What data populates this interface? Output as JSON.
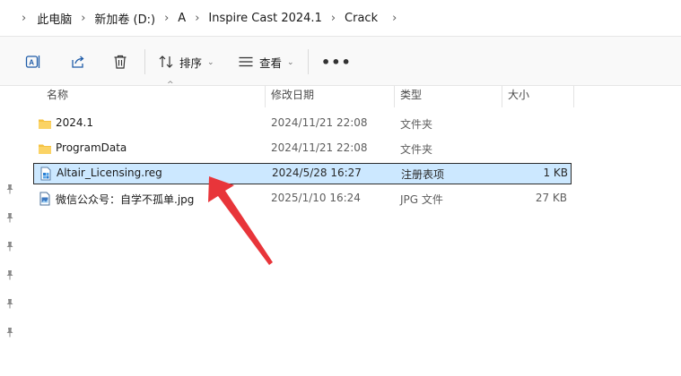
{
  "breadcrumb": {
    "items": [
      "此电脑",
      "新加卷 (D:)",
      "A",
      "Inspire Cast 2024.1",
      "Crack"
    ],
    "separator": "›"
  },
  "toolbar": {
    "sort_label": "排序",
    "view_label": "查看",
    "more_label": "•••",
    "icons": [
      "rename-icon",
      "share-icon",
      "delete-icon",
      "sort-icon",
      "view-icon"
    ]
  },
  "columns": {
    "name": "名称",
    "modified": "修改日期",
    "type": "类型",
    "size": "大小"
  },
  "files": [
    {
      "name": "2024.1",
      "modified": "2024/11/21 22:08",
      "type": "文件夹",
      "size": "",
      "icon": "folder-icon",
      "selected": false
    },
    {
      "name": "ProgramData",
      "modified": "2024/11/21 22:08",
      "type": "文件夹",
      "size": "",
      "icon": "folder-icon",
      "selected": false
    },
    {
      "name": "Altair_Licensing.reg",
      "modified": "2024/5/28 16:27",
      "type": "注册表项",
      "size": "1 KB",
      "icon": "registry-file-icon",
      "selected": true
    },
    {
      "name": "微信公众号：自学不孤单.jpg",
      "modified": "2025/1/10 16:24",
      "type": "JPG 文件",
      "size": "27 KB",
      "icon": "image-file-icon",
      "selected": false
    }
  ],
  "colors": {
    "selection_bg": "#cce8ff",
    "folder": "#f5c242",
    "arrow": "#e8353a"
  }
}
